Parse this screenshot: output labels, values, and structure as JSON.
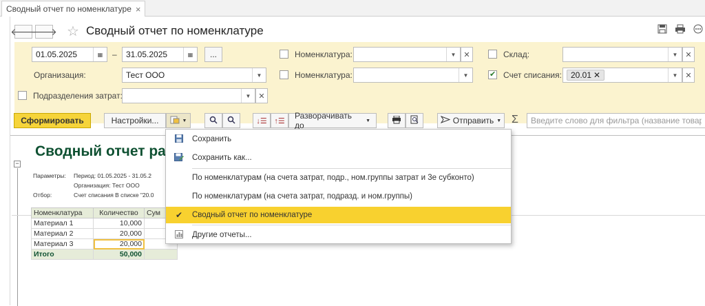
{
  "tab": {
    "title": "Сводный отчет по номенклатуре",
    "close": "×"
  },
  "header": {
    "title": "Сводный отчет по номенклатуре",
    "back": "🡐",
    "forward": "🡒",
    "star": "☆",
    "icons": [
      "save-icon",
      "print-icon",
      "more-icon"
    ]
  },
  "filters": {
    "date_from": "01.05.2025",
    "date_dash": "–",
    "date_to": "31.05.2025",
    "period_btn": "...",
    "org_label": "Организация:",
    "org_value": "Тест ООО",
    "subdiv_label": "Подразделения затрат:",
    "nom1_label": "Номенклатура:",
    "nom2_label": "Номенклатура:",
    "warehouse_label": "Склад:",
    "account_label": "Счет списания:",
    "account_tag": "20.01",
    "account_checked": true
  },
  "toolbar": {
    "generate": "Сформировать",
    "settings": "Настройки...",
    "expand": "Разворачивать до",
    "send": "Отправить",
    "sigma": "Σ",
    "search_placeholder": "Введите слово для фильтра (название товара..."
  },
  "report": {
    "title": "Сводный отчет ра",
    "params_label": "Параметры:",
    "params_line1": "Период: 01.05.2025 - 31.05.2",
    "params_line2": "Организация: Тест ООО",
    "filter_label": "Отбор:",
    "filter_value": "Счет списания В списке \"20.0",
    "columns": [
      "Номенклатура",
      "Количество",
      "Сум"
    ],
    "rows": [
      {
        "name": "Материал 1",
        "qty": "10,000"
      },
      {
        "name": "Материал 2",
        "qty": "20,000"
      },
      {
        "name": "Материал 3",
        "qty": "20,000"
      }
    ],
    "total_label": "Итого",
    "total_qty": "50,000"
  },
  "menu": {
    "save": "Сохранить",
    "save_as": "Сохранить как...",
    "opt1": "По номенклатурам (на счета затрат, подр., ном.группы затрат и 3е субконто)",
    "opt2": "По номенклатурам (на счета затрат, подразд. и ном.группы)",
    "opt3": "Сводный отчет по номенклатуре",
    "other": "Другие отчеты..."
  },
  "colors": {
    "accent": "#f6d43a",
    "filter_bg": "#fbf3cf",
    "title_green": "#0f5132",
    "menu_active": "#f8d12f"
  }
}
